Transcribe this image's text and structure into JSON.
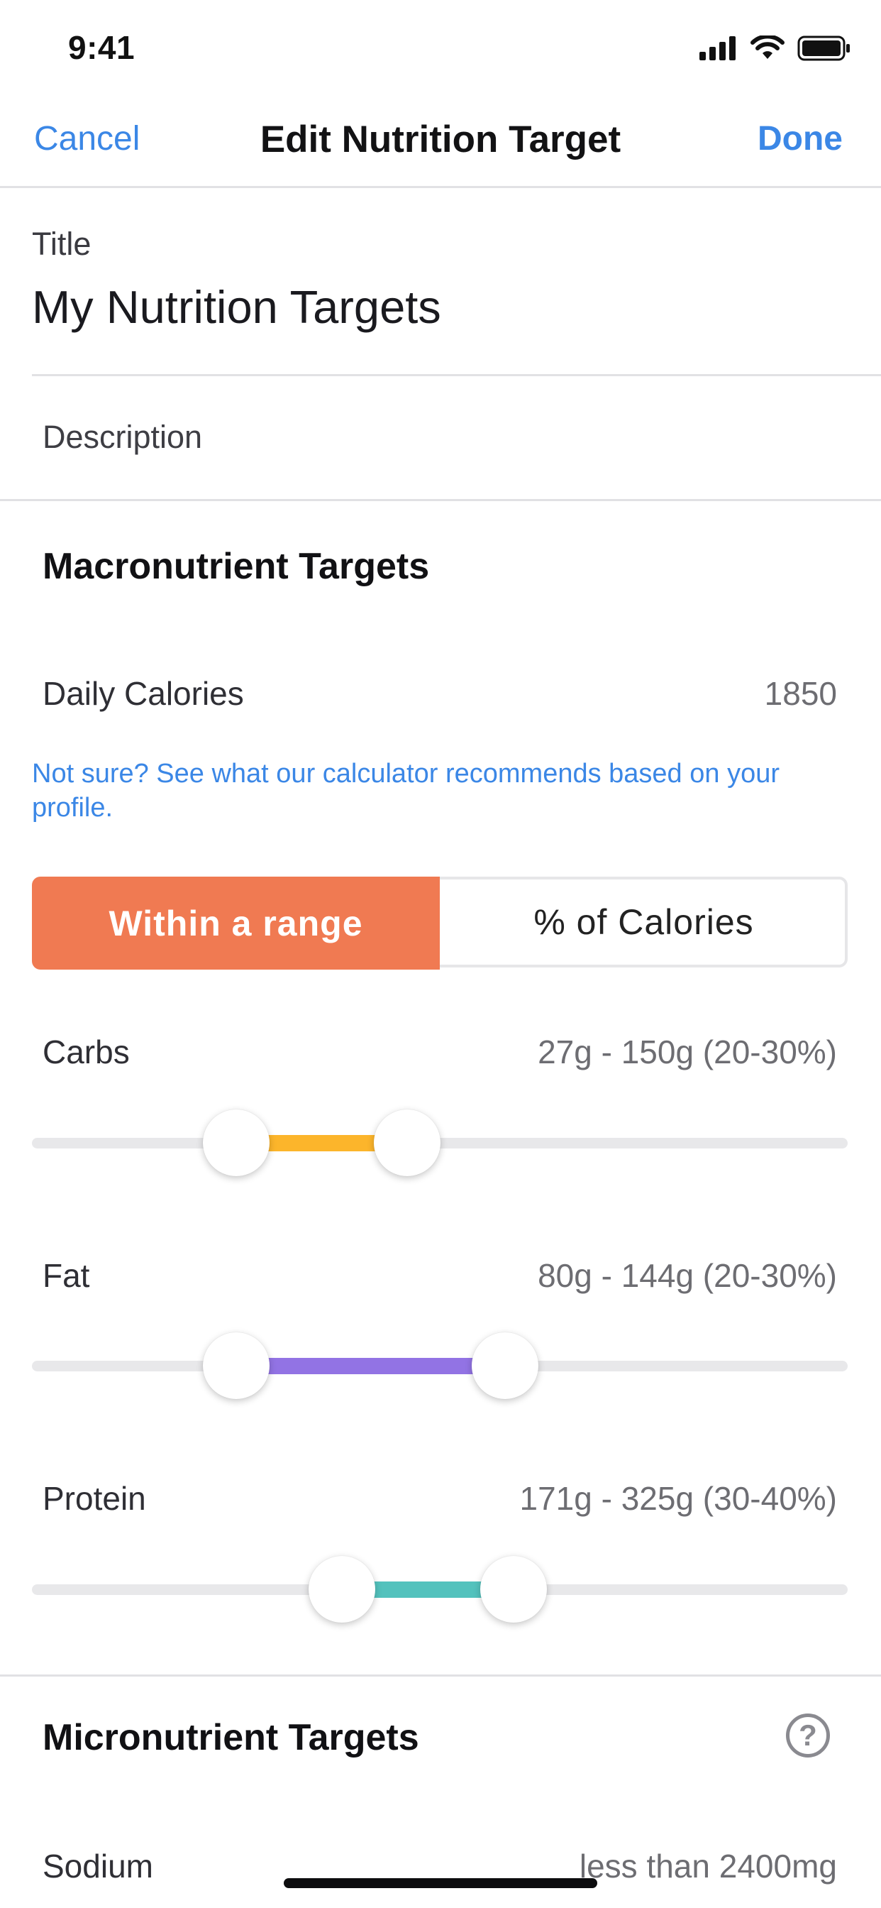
{
  "status_bar": {
    "time": "9:41"
  },
  "nav": {
    "cancel_label": "Cancel",
    "title": "Edit Nutrition Target",
    "done_label": "Done"
  },
  "form": {
    "title_label": "Title",
    "title_value": "My Nutrition Targets",
    "description_placeholder": "Description"
  },
  "macros": {
    "heading": "Macronutrient Targets",
    "daily_calories_label": "Daily Calories",
    "daily_calories_value": "1850",
    "calculator_link": "Not sure? See what our calculator recommends based on your profile.",
    "mode_options": [
      "Within a range",
      "% of Calories"
    ],
    "selected_mode": "Within a range",
    "sliders": [
      {
        "label": "Carbs",
        "value_text": "27g - 150g (20-30%)",
        "color": "#fcb52b",
        "range": [
          0.25,
          0.46
        ]
      },
      {
        "label": "Fat",
        "value_text": "80g - 144g (20-30%)",
        "color": "#9273e4",
        "range": [
          0.25,
          0.58
        ]
      },
      {
        "label": "Protein",
        "value_text": "171g - 325g (30-40%)",
        "color": "#53c2bd",
        "range": [
          0.38,
          0.59
        ]
      }
    ]
  },
  "micros": {
    "heading": "Micronutrient Targets",
    "help_icon": "question-circle-icon",
    "rows": [
      {
        "label": "Sodium",
        "value_text": "less than 2400mg"
      }
    ]
  },
  "colors": {
    "accent": "#3b87e6",
    "selected_segment": "#f07a52"
  }
}
